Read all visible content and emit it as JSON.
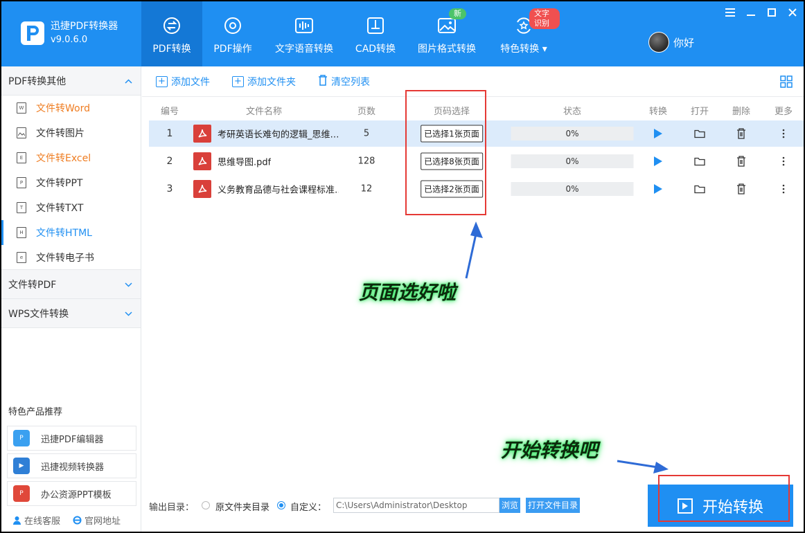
{
  "app": {
    "name": "迅捷PDF转换器",
    "version": "v9.0.6.0"
  },
  "nav": {
    "items": [
      {
        "label": "PDF转换",
        "icon": "convert-icon"
      },
      {
        "label": "PDF操作",
        "icon": "gear-icon"
      },
      {
        "label": "文字语音转换",
        "icon": "sound-wave-icon"
      },
      {
        "label": "CAD转换",
        "icon": "cad-icon"
      },
      {
        "label": "图片格式转换",
        "icon": "image-icon"
      },
      {
        "label": "特色转换",
        "icon": "star-refresh-icon"
      }
    ],
    "badge_new": "新",
    "badge_ocr": "文字识别"
  },
  "user": {
    "name": "你好"
  },
  "sidebar": {
    "group1": "PDF转换其他",
    "items": [
      {
        "label": "文件转Word",
        "tag": "W"
      },
      {
        "label": "文件转图片",
        "tag": ""
      },
      {
        "label": "文件转Excel",
        "tag": "E"
      },
      {
        "label": "文件转PPT",
        "tag": "P"
      },
      {
        "label": "文件转TXT",
        "tag": "T"
      },
      {
        "label": "文件转HTML",
        "tag": "H"
      },
      {
        "label": "文件转电子书",
        "tag": "e"
      }
    ],
    "group2": "文件转PDF",
    "group3": "WPS文件转换",
    "recommend_title": "特色产品推荐",
    "recommend": [
      {
        "label": "迅捷PDF编辑器"
      },
      {
        "label": "迅捷视频转换器"
      },
      {
        "label": "办公资源PPT模板"
      }
    ],
    "footer": {
      "service": "在线客服",
      "website": "官网地址"
    }
  },
  "toolbar": {
    "add_file": "添加文件",
    "add_folder": "添加文件夹",
    "clear_list": "清空列表"
  },
  "table": {
    "headers": {
      "num": "编号",
      "name": "文件名称",
      "pages": "页数",
      "page_select": "页码选择",
      "status": "状态",
      "convert": "转换",
      "open": "打开",
      "delete": "删除",
      "more": "更多"
    },
    "rows": [
      {
        "num": "1",
        "name": "考研英语长难句的逻辑_思维…",
        "pages": "5",
        "select": "已选择1张页面",
        "progress": "0%"
      },
      {
        "num": "2",
        "name": "思维导图.pdf",
        "pages": "128",
        "select": "已选择8张页面",
        "progress": "0%"
      },
      {
        "num": "3",
        "name": "义务教育品德与社会课程标准…",
        "pages": "12",
        "select": "已选择2张页面",
        "progress": "0%"
      }
    ]
  },
  "annotations": {
    "pages_done": "页面选好啦",
    "start_hint": "开始转换吧"
  },
  "bottom": {
    "output_label": "输出目录：",
    "opt_source": "原文件夹目录",
    "opt_custom": "自定义：",
    "path_value": "C:\\Users\\Administrator\\Desktop",
    "browse": "浏览",
    "open_dir": "打开文件目录",
    "start": "开始转换"
  },
  "colors": {
    "brand_blue": "#1f8ff2",
    "highlight_row": "#dcebfb",
    "annotation_red": "#e53935",
    "annotation_glow": "#3fe86a"
  }
}
